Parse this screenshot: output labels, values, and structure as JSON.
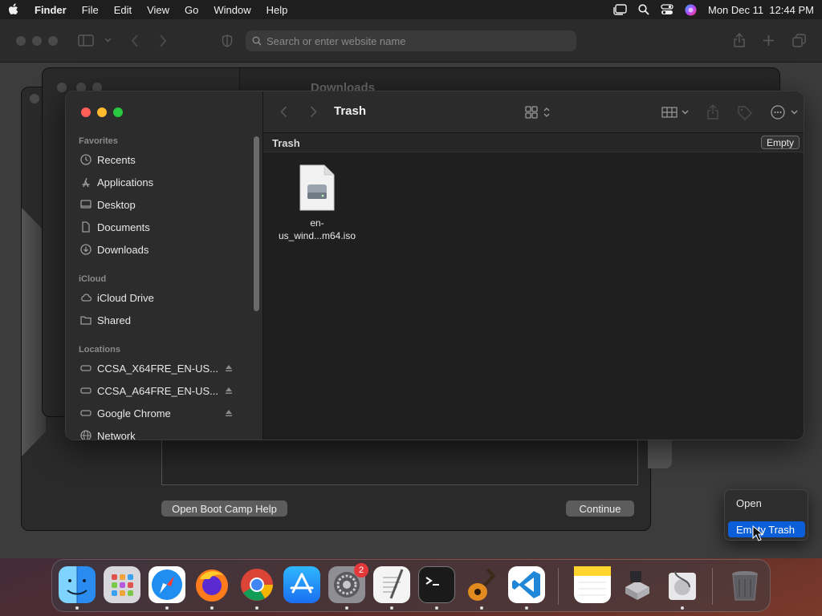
{
  "menubar": {
    "app_name": "Finder",
    "menus": [
      "File",
      "Edit",
      "View",
      "Go",
      "Window",
      "Help"
    ],
    "clock": "Mon Dec 11  12:44 PM"
  },
  "browser": {
    "search_placeholder": "Search or enter website name"
  },
  "background_finder": {
    "title": "Downloads"
  },
  "bootcamp": {
    "help_button": "Open Boot Camp Help",
    "continue_button": "Continue"
  },
  "finder": {
    "title": "Trash",
    "path_label": "Trash",
    "empty_button": "Empty",
    "sections": {
      "favorites": "Favorites",
      "icloud": "iCloud",
      "locations": "Locations"
    },
    "favorites": [
      "Recents",
      "Applications",
      "Desktop",
      "Documents",
      "Downloads"
    ],
    "icloud": [
      "iCloud Drive",
      "Shared"
    ],
    "locations": [
      "CCSA_X64FRE_EN-US...",
      "CCSA_A64FRE_EN-US...",
      "Google Chrome",
      "Network"
    ],
    "file": {
      "name_line1": "en-",
      "name_line2": "us_wind...m64.iso"
    }
  },
  "context_menu": {
    "items": [
      "Open",
      "Empty Trash"
    ],
    "selected": "Empty Trash"
  },
  "dock": {
    "apps": [
      "Finder",
      "Launchpad",
      "Safari",
      "Firefox",
      "Google Chrome",
      "App Store",
      "System Settings",
      "TextEdit",
      "Terminal",
      "GarageBand",
      "Visual Studio Code",
      "Notes",
      "Boot Camp Assistant",
      "Disk Utility",
      "Trash"
    ],
    "settings_badge": "2"
  },
  "colors": {
    "accent": "#0a5fd8",
    "close": "#ff5f57",
    "minimize": "#febc2e",
    "zoom": "#28c840",
    "badge": "#e5383b"
  }
}
